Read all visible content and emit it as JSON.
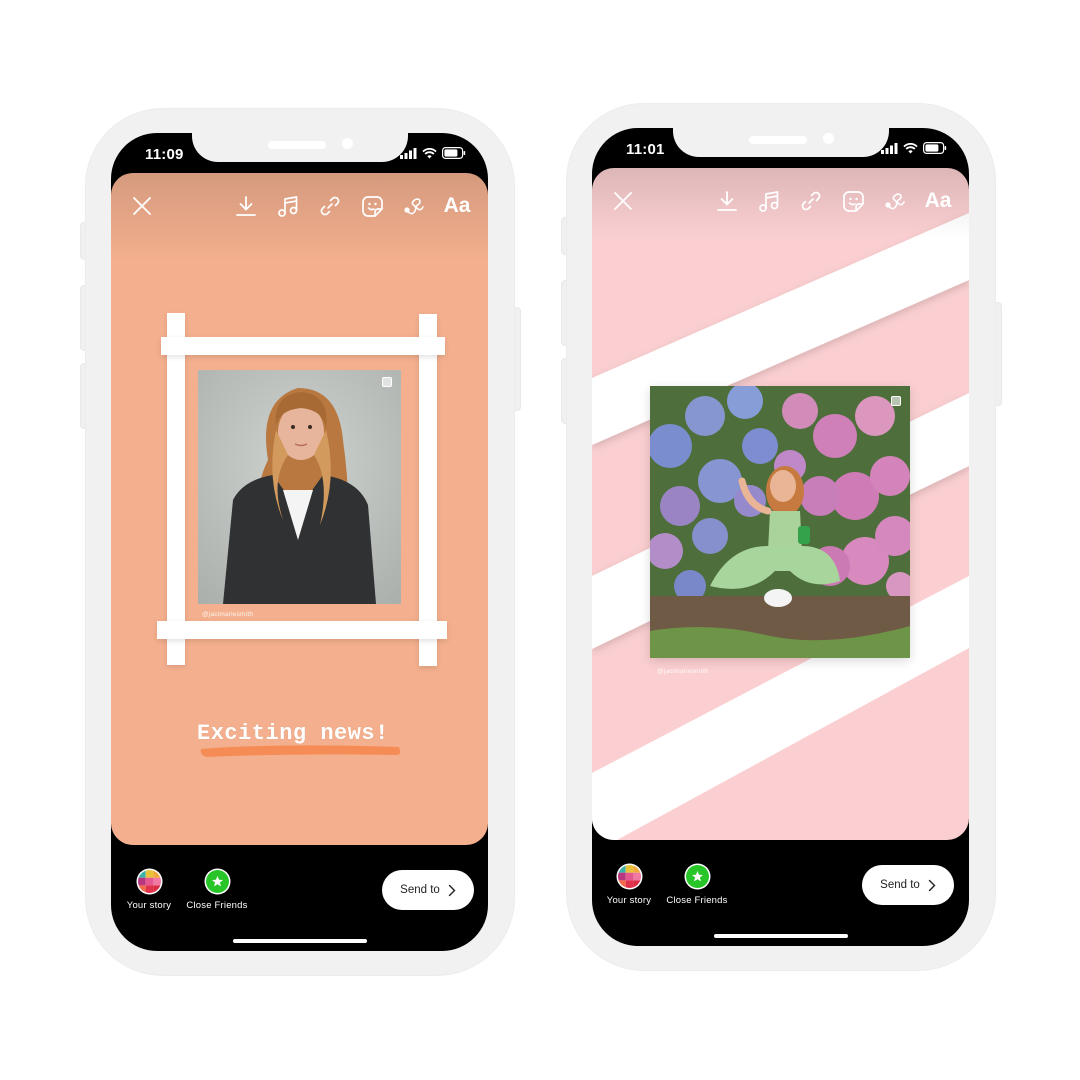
{
  "phones": [
    {
      "status": {
        "time": "11:09"
      },
      "canvas_color": "#f4b08e",
      "canvas_top_color": "#d59a7e",
      "toolbar": {
        "icons": [
          "close-icon",
          "download-icon",
          "music-icon",
          "link-icon",
          "sticker-icon",
          "draw-icon"
        ],
        "text_tool_label": "Aa"
      },
      "post": {
        "handle": "@jacimariesmith",
        "photo_desc": "Woman with wavy hair in black leather blazer against grey wall"
      },
      "caption": {
        "text": "Exciting news!",
        "highlight_color": "#f58b55"
      },
      "share": {
        "your_story_label": "Your story",
        "close_friends_label": "Close Friends",
        "send_label": "Send to"
      }
    },
    {
      "status": {
        "time": "11:01"
      },
      "canvas_color": "#fbcfd1",
      "canvas_top_color": "#dfb3b4",
      "toolbar": {
        "icons": [
          "close-icon",
          "download-icon",
          "music-icon",
          "link-icon",
          "sticker-icon",
          "draw-icon"
        ],
        "text_tool_label": "Aa"
      },
      "post": {
        "handle": "@jacimariesmith",
        "photo_desc": "Woman in green outfit sitting in front of hydrangea bushes"
      },
      "share": {
        "your_story_label": "Your story",
        "close_friends_label": "Close Friends",
        "send_label": "Send to"
      }
    }
  ],
  "colors": {
    "frame": "#f1f1f1",
    "close_friends_green": "#28c528"
  }
}
